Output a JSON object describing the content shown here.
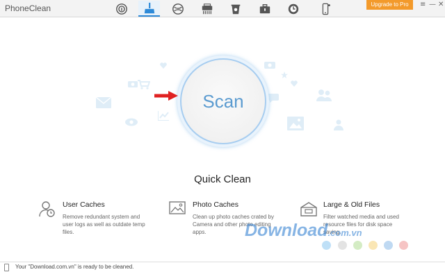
{
  "app": {
    "title": "PhoneClean"
  },
  "toolbar": {
    "tools": [
      {
        "name": "privacy-clean",
        "icon": "fingerprint-icon",
        "active": false
      },
      {
        "name": "quick-clean",
        "icon": "broom-icon",
        "active": true
      },
      {
        "name": "internet-clean",
        "icon": "globe-icon",
        "active": false
      },
      {
        "name": "deep-clean",
        "icon": "shredder-icon",
        "active": false
      },
      {
        "name": "silent-clean",
        "icon": "bin-icon",
        "active": false
      },
      {
        "name": "toolbox",
        "icon": "toolbox-icon",
        "active": false
      },
      {
        "name": "history",
        "icon": "clock-icon",
        "active": false
      },
      {
        "name": "device",
        "icon": "phone-icon",
        "active": false
      }
    ],
    "upgrade_label": "Upgrade to Pro",
    "window_controls": {
      "menu": "≡",
      "minimize": "—",
      "close": "✕"
    }
  },
  "main": {
    "scan_label": "Scan",
    "mode_title": "Quick Clean",
    "features": [
      {
        "name": "User Caches",
        "desc": "Remove redundant system and user logs as well as outdate temp files.",
        "icon": "user-clock-icon"
      },
      {
        "name": "Photo Caches",
        "desc": "Clean up photo caches crated by Camera and other photo editing apps.",
        "icon": "photo-icon"
      },
      {
        "name": "Large & Old Files",
        "desc": "Filter watched media and used resource files for disk space saving.",
        "icon": "box-icon"
      }
    ],
    "color_dots": [
      "#bfe0f7",
      "#e3e3e3",
      "#d4ecc4",
      "#fae6b4",
      "#bfd9f2",
      "#f6c4c4"
    ]
  },
  "watermark": {
    "text": "Download",
    "suffix": ".com.vn"
  },
  "status": {
    "text": "Your \"Download.com.vn\" is ready to be cleaned."
  },
  "colors": {
    "accent": "#2e8ad8",
    "upgrade": "#f39a2b",
    "arrow": "#e02222",
    "scan_text": "#5b9bd0"
  }
}
